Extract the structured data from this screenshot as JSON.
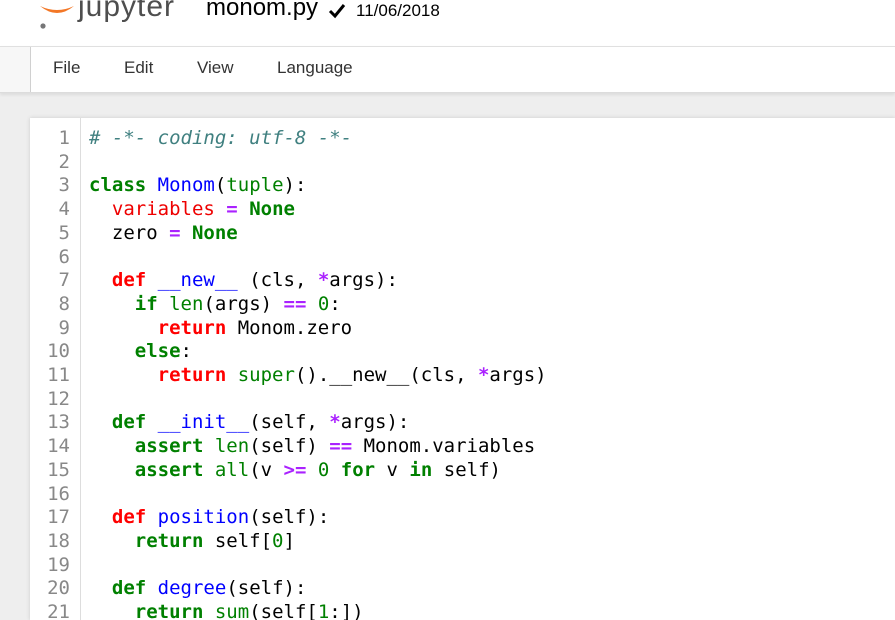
{
  "header": {
    "logo_text": "jupyter",
    "filename": "monom.py",
    "saved_date": "11/06/2018"
  },
  "menubar": {
    "items": [
      "File",
      "Edit",
      "View",
      "Language"
    ]
  },
  "colors": {
    "comment": "#408080",
    "keyword": "#008000",
    "def_keyword": "#ff0000",
    "name": "#0000ff",
    "variable": "#ee0000",
    "operator": "#aa22ff",
    "number": "#008000",
    "logo_orange": "#f37726"
  },
  "code_lines": [
    {
      "num": "1",
      "tokens": [
        {
          "t": "# -*- coding: utf-8 -*-",
          "c": "comment"
        }
      ]
    },
    {
      "num": "2",
      "tokens": []
    },
    {
      "num": "3",
      "tokens": [
        {
          "t": "class",
          "c": "keyword"
        },
        {
          "t": " ",
          "c": "plain"
        },
        {
          "t": "Monom",
          "c": "name"
        },
        {
          "t": "(",
          "c": "plain"
        },
        {
          "t": "tuple",
          "c": "builtin"
        },
        {
          "t": "):",
          "c": "plain"
        }
      ]
    },
    {
      "num": "4",
      "tokens": [
        {
          "t": "  ",
          "c": "plain"
        },
        {
          "t": "variables",
          "c": "var"
        },
        {
          "t": " ",
          "c": "plain"
        },
        {
          "t": "=",
          "c": "op"
        },
        {
          "t": " ",
          "c": "plain"
        },
        {
          "t": "None",
          "c": "keyword"
        }
      ]
    },
    {
      "num": "5",
      "tokens": [
        {
          "t": "  zero ",
          "c": "plain"
        },
        {
          "t": "=",
          "c": "op"
        },
        {
          "t": " ",
          "c": "plain"
        },
        {
          "t": "None",
          "c": "keyword"
        }
      ]
    },
    {
      "num": "6",
      "tokens": []
    },
    {
      "num": "7",
      "tokens": [
        {
          "t": "  ",
          "c": "plain"
        },
        {
          "t": "def",
          "c": "def"
        },
        {
          "t": " ",
          "c": "plain"
        },
        {
          "t": "__new__",
          "c": "name"
        },
        {
          "t": " (cls, ",
          "c": "plain"
        },
        {
          "t": "*",
          "c": "op"
        },
        {
          "t": "args):",
          "c": "plain"
        }
      ]
    },
    {
      "num": "8",
      "tokens": [
        {
          "t": "    ",
          "c": "plain"
        },
        {
          "t": "if",
          "c": "keyword"
        },
        {
          "t": " ",
          "c": "plain"
        },
        {
          "t": "len",
          "c": "builtin"
        },
        {
          "t": "(args) ",
          "c": "plain"
        },
        {
          "t": "==",
          "c": "op"
        },
        {
          "t": " ",
          "c": "plain"
        },
        {
          "t": "0",
          "c": "num"
        },
        {
          "t": ":",
          "c": "plain"
        }
      ]
    },
    {
      "num": "9",
      "tokens": [
        {
          "t": "      ",
          "c": "plain"
        },
        {
          "t": "return",
          "c": "def"
        },
        {
          "t": " Monom.zero",
          "c": "plain"
        }
      ]
    },
    {
      "num": "10",
      "tokens": [
        {
          "t": "    ",
          "c": "plain"
        },
        {
          "t": "else",
          "c": "keyword"
        },
        {
          "t": ":",
          "c": "plain"
        }
      ]
    },
    {
      "num": "11",
      "tokens": [
        {
          "t": "      ",
          "c": "plain"
        },
        {
          "t": "return",
          "c": "def"
        },
        {
          "t": " ",
          "c": "plain"
        },
        {
          "t": "super",
          "c": "builtin"
        },
        {
          "t": "().__new__(cls, ",
          "c": "plain"
        },
        {
          "t": "*",
          "c": "op"
        },
        {
          "t": "args)",
          "c": "plain"
        }
      ]
    },
    {
      "num": "12",
      "tokens": []
    },
    {
      "num": "13",
      "tokens": [
        {
          "t": "  ",
          "c": "plain"
        },
        {
          "t": "def",
          "c": "keyword"
        },
        {
          "t": " ",
          "c": "plain"
        },
        {
          "t": "__init__",
          "c": "name"
        },
        {
          "t": "(self, ",
          "c": "plain"
        },
        {
          "t": "*",
          "c": "op"
        },
        {
          "t": "args):",
          "c": "plain"
        }
      ]
    },
    {
      "num": "14",
      "tokens": [
        {
          "t": "    ",
          "c": "plain"
        },
        {
          "t": "assert",
          "c": "keyword"
        },
        {
          "t": " ",
          "c": "plain"
        },
        {
          "t": "len",
          "c": "builtin"
        },
        {
          "t": "(self) ",
          "c": "plain"
        },
        {
          "t": "==",
          "c": "op"
        },
        {
          "t": " Monom.variables",
          "c": "plain"
        }
      ]
    },
    {
      "num": "15",
      "tokens": [
        {
          "t": "    ",
          "c": "plain"
        },
        {
          "t": "assert",
          "c": "keyword"
        },
        {
          "t": " ",
          "c": "plain"
        },
        {
          "t": "all",
          "c": "builtin"
        },
        {
          "t": "(v ",
          "c": "plain"
        },
        {
          "t": ">=",
          "c": "op"
        },
        {
          "t": " ",
          "c": "plain"
        },
        {
          "t": "0",
          "c": "num"
        },
        {
          "t": " ",
          "c": "plain"
        },
        {
          "t": "for",
          "c": "keyword"
        },
        {
          "t": " v ",
          "c": "plain"
        },
        {
          "t": "in",
          "c": "keyword"
        },
        {
          "t": " self)",
          "c": "plain"
        }
      ]
    },
    {
      "num": "16",
      "tokens": []
    },
    {
      "num": "17",
      "tokens": [
        {
          "t": "  ",
          "c": "plain"
        },
        {
          "t": "def",
          "c": "def"
        },
        {
          "t": " ",
          "c": "plain"
        },
        {
          "t": "position",
          "c": "name"
        },
        {
          "t": "(self):",
          "c": "plain"
        }
      ]
    },
    {
      "num": "18",
      "tokens": [
        {
          "t": "    ",
          "c": "plain"
        },
        {
          "t": "return",
          "c": "keyword"
        },
        {
          "t": " self[",
          "c": "plain"
        },
        {
          "t": "0",
          "c": "num"
        },
        {
          "t": "]",
          "c": "plain"
        }
      ]
    },
    {
      "num": "19",
      "tokens": []
    },
    {
      "num": "20",
      "tokens": [
        {
          "t": "  ",
          "c": "plain"
        },
        {
          "t": "def",
          "c": "keyword"
        },
        {
          "t": " ",
          "c": "plain"
        },
        {
          "t": "degree",
          "c": "name"
        },
        {
          "t": "(self):",
          "c": "plain"
        }
      ]
    },
    {
      "num": "21",
      "tokens": [
        {
          "t": "    ",
          "c": "plain"
        },
        {
          "t": "return",
          "c": "keyword"
        },
        {
          "t": " ",
          "c": "plain"
        },
        {
          "t": "sum",
          "c": "builtin"
        },
        {
          "t": "(self[",
          "c": "plain"
        },
        {
          "t": "1",
          "c": "num"
        },
        {
          "t": ":])",
          "c": "plain"
        }
      ]
    }
  ]
}
